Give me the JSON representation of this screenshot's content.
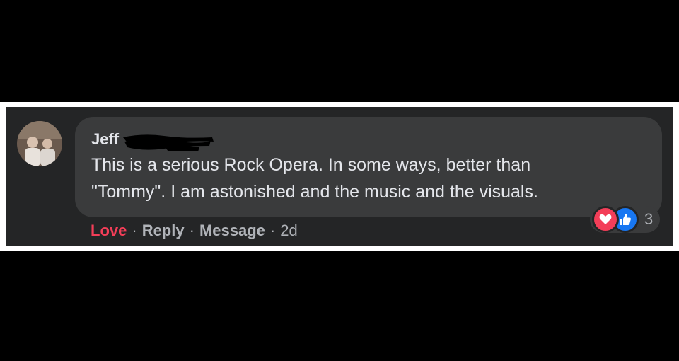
{
  "comment": {
    "author": "Jeff",
    "text_line1": "This is a serious Rock Opera. In some ways, better than",
    "text_line2": "\"Tommy\". I am astonished and the music and the visuals.",
    "reactions": {
      "icons": [
        "heart-icon",
        "thumbs-up-icon"
      ],
      "count": "3"
    },
    "actions": {
      "love_label": "Love",
      "reply_label": "Reply",
      "message_label": "Message",
      "separator": "·",
      "timestamp": "2d"
    }
  },
  "colors": {
    "background": "#000000",
    "panel": "#242526",
    "bubble": "#3a3b3c",
    "text": "#e4e6eb",
    "secondary_text": "#b0b3b8",
    "love": "#f33e58",
    "like": "#1877f2"
  }
}
